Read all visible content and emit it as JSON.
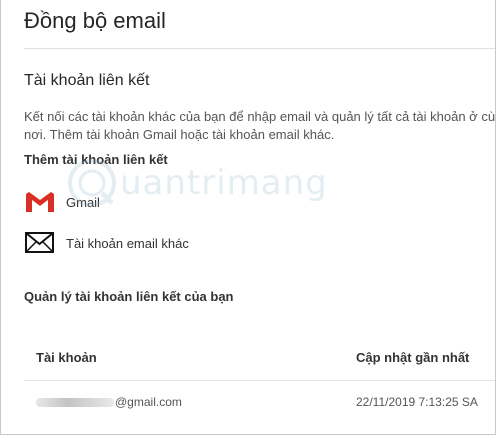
{
  "page": {
    "title": "Đồng bộ email"
  },
  "linked_accounts": {
    "heading": "Tài khoản liên kết",
    "description": "Kết nối các tài khoản khác của bạn để nhập email và quản lý tất cả tài khoản ở cùng một nơi. Thêm tài khoản Gmail hoặc tài khoản email khác.",
    "add_label": "Thêm tài khoản liên kết",
    "options": [
      {
        "label": "Gmail",
        "icon": "gmail-icon"
      },
      {
        "label": "Tài khoản email khác",
        "icon": "envelope-icon"
      }
    ]
  },
  "manage": {
    "heading": "Quản lý tài khoản liên kết của bạn",
    "columns": {
      "account": "Tài khoản",
      "last_updated": "Cập nhật gần nhất"
    },
    "rows": [
      {
        "email": "@gmail.com",
        "last_updated": "22/11/2019 7:13:25 SA"
      }
    ]
  },
  "watermark": {
    "text": "uantrimang"
  },
  "colors": {
    "gmail_red": "#d93025",
    "divider": "#e1e1e1",
    "text": "#333333"
  }
}
